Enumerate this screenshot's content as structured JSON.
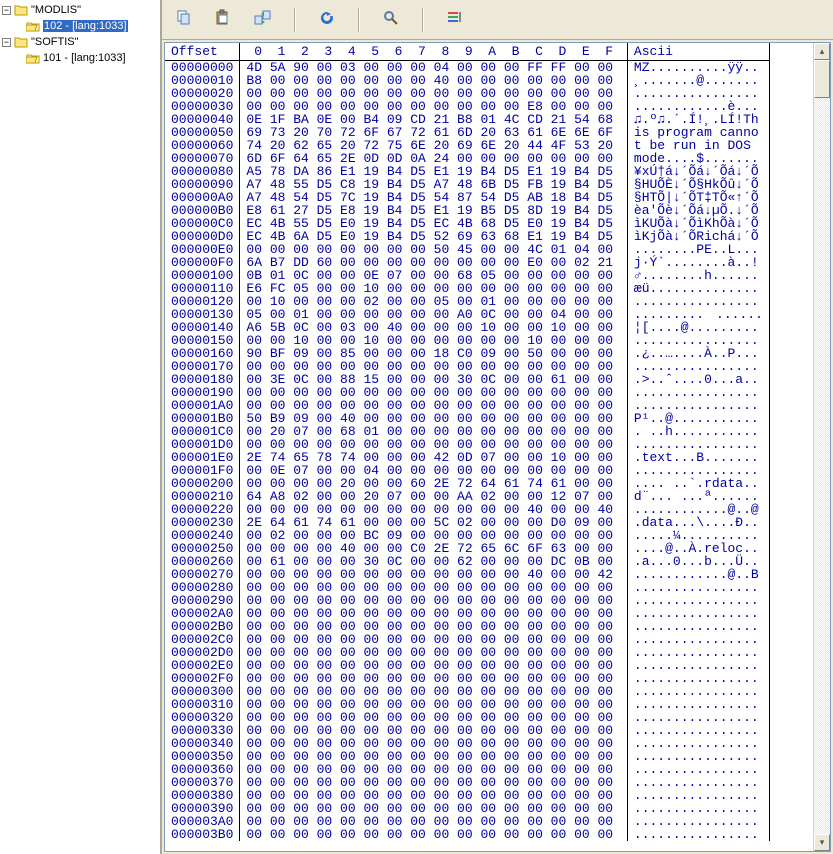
{
  "sidebar": {
    "nodes": [
      {
        "depth": 0,
        "toggle": "−",
        "icon": "folder-closed",
        "label": "\"MODLIS\""
      },
      {
        "depth": 1,
        "toggle": "",
        "icon": "folder-open",
        "label": "102 - [lang:1033]",
        "selected": true
      },
      {
        "depth": 0,
        "toggle": "−",
        "icon": "folder-closed",
        "label": "\"SOFTIS\""
      },
      {
        "depth": 1,
        "toggle": "",
        "icon": "folder-open",
        "label": "101 - [lang:1033]"
      }
    ]
  },
  "toolbar": {
    "buttons": [
      {
        "name": "copy-icon"
      },
      {
        "name": "paste-icon"
      },
      {
        "name": "swap-icon"
      },
      {
        "sep": true
      },
      {
        "name": "refresh-icon"
      },
      {
        "sep": true
      },
      {
        "name": "find-icon"
      },
      {
        "sep": true
      },
      {
        "name": "options-icon"
      }
    ]
  },
  "hex": {
    "header_offset": "Offset",
    "header_cols": [
      "0",
      "1",
      "2",
      "3",
      "4",
      "5",
      "6",
      "7",
      "8",
      "9",
      "A",
      "B",
      "C",
      "D",
      "E",
      "F"
    ],
    "header_ascii": "Ascii",
    "rows": [
      {
        "o": "00000000",
        "h": "4D 5A 90 00 03 00 00 00 04 00 00 00 FF FF 00 00",
        "a": "MZ..........ÿÿ.."
      },
      {
        "o": "00000010",
        "h": "B8 00 00 00 00 00 00 00 40 00 00 00 00 00 00 00",
        "a": "¸.......@......."
      },
      {
        "o": "00000020",
        "h": "00 00 00 00 00 00 00 00 00 00 00 00 00 00 00 00",
        "a": "................"
      },
      {
        "o": "00000030",
        "h": "00 00 00 00 00 00 00 00 00 00 00 00 E8 00 00 00",
        "a": "............è..."
      },
      {
        "o": "00000040",
        "h": "0E 1F BA 0E 00 B4 09 CD 21 B8 01 4C CD 21 54 68",
        "a": "♫.º♫.´.Í!¸.LÍ!Th"
      },
      {
        "o": "00000050",
        "h": "69 73 20 70 72 6F 67 72 61 6D 20 63 61 6E 6E 6F",
        "a": "is program canno"
      },
      {
        "o": "00000060",
        "h": "74 20 62 65 20 72 75 6E 20 69 6E 20 44 4F 53 20",
        "a": "t be run in DOS "
      },
      {
        "o": "00000070",
        "h": "6D 6F 64 65 2E 0D 0D 0A 24 00 00 00 00 00 00 00",
        "a": "mode....$......."
      },
      {
        "o": "00000080",
        "h": "A5 78 DA 86 E1 19 B4 D5 E1 19 B4 D5 E1 19 B4 D5",
        "a": "¥xÚ†á↓´Õá↓´Õá↓´Õ"
      },
      {
        "o": "00000090",
        "h": "A7 48 55 D5 C8 19 B4 D5 A7 48 6B D5 FB 19 B4 D5",
        "a": "§HUÕÈ↓´Õ§HkÕû↓´Õ"
      },
      {
        "o": "000000A0",
        "h": "A7 48 54 D5 7C 19 B4 D5 54 87 54 D5 AB 18 B4 D5",
        "a": "§HTÕ|↓´ÕT‡TÕ«↑´Õ"
      },
      {
        "o": "000000B0",
        "h": "E8 61 27 D5 E8 19 B4 D5 E1 19 B5 D5 8D 19 B4 D5",
        "a": "èa'Õè↓´Õá↓µÕ.↓´Õ"
      },
      {
        "o": "000000C0",
        "h": "EC 4B 55 D5 E0 19 B4 D5 EC 4B 68 D5 E0 19 B4 D5",
        "a": "ìKUÕà↓´ÕìKhÕà↓´Õ"
      },
      {
        "o": "000000D0",
        "h": "EC 4B 6A D5 E0 19 B4 D5 52 69 63 68 E1 19 B4 D5",
        "a": "ìKjÕà↓´ÕRichá↓´Õ"
      },
      {
        "o": "000000E0",
        "h": "00 00 00 00 00 00 00 00 50 45 00 00 4C 01 04 00",
        "a": "........PE..L..."
      },
      {
        "o": "000000F0",
        "h": "6A B7 DD 60 00 00 00 00 00 00 00 00 E0 00 02 21",
        "a": "j·Ý`........à..!"
      },
      {
        "o": "00000100",
        "h": "0B 01 0C 00 00 0E 07 00 00 68 05 00 00 00 00 00",
        "a": "♂........h......"
      },
      {
        "o": "00000110",
        "h": "E6 FC 05 00 00 10 00 00 00 00 00 00 00 00 00 00",
        "a": "æü.............."
      },
      {
        "o": "00000120",
        "h": "00 10 00 00 00 02 00 00 05 00 01 00 00 00 00 00",
        "a": "................"
      },
      {
        "o": "00000130",
        "h": "05 00 01 00 00 00 00 00 00 A0 0C 00 00 04 00 00",
        "a": ".........ﾠ......"
      },
      {
        "o": "00000140",
        "h": "A6 5B 0C 00 03 00 40 00 00 00 10 00 00 10 00 00",
        "a": "¦[....@........."
      },
      {
        "o": "00000150",
        "h": "00 00 10 00 00 10 00 00 00 00 00 00 10 00 00 00",
        "a": "................"
      },
      {
        "o": "00000160",
        "h": "90 BF 09 00 85 00 00 00 18 C0 09 00 50 00 00 00",
        "a": ".¿..…....À..P..."
      },
      {
        "o": "00000170",
        "h": "00 00 00 00 00 00 00 00 00 00 00 00 00 00 00 00",
        "a": "................"
      },
      {
        "o": "00000180",
        "h": "00 3E 0C 00 88 15 00 00 00 30 0C 00 00 61 00 00",
        "a": ".>..ˆ....0...a.."
      },
      {
        "o": "00000190",
        "h": "00 00 00 00 00 00 00 00 00 00 00 00 00 00 00 00",
        "a": "................"
      },
      {
        "o": "000001A0",
        "h": "00 00 00 00 00 00 00 00 00 00 00 00 00 00 00 00",
        "a": "................"
      },
      {
        "o": "000001B0",
        "h": "50 B9 09 00 40 00 00 00 00 00 00 00 00 00 00 00",
        "a": "P¹..@..........."
      },
      {
        "o": "000001C0",
        "h": "00 20 07 00 68 01 00 00 00 00 00 00 00 00 00 00",
        "a": ". ..h..........."
      },
      {
        "o": "000001D0",
        "h": "00 00 00 00 00 00 00 00 00 00 00 00 00 00 00 00",
        "a": "................"
      },
      {
        "o": "000001E0",
        "h": "2E 74 65 78 74 00 00 00 42 0D 07 00 00 10 00 00",
        "a": ".text...B......."
      },
      {
        "o": "000001F0",
        "h": "00 0E 07 00 00 04 00 00 00 00 00 00 00 00 00 00",
        "a": "................"
      },
      {
        "o": "00000200",
        "h": "00 00 00 00 20 00 00 60 2E 72 64 61 74 61 00 00",
        "a": ".... ..`.rdata.."
      },
      {
        "o": "00000210",
        "h": "64 A8 02 00 00 20 07 00 00 AA 02 00 00 12 07 00",
        "a": "d¨... ...ª......"
      },
      {
        "o": "00000220",
        "h": "00 00 00 00 00 00 00 00 00 00 00 00 40 00 00 40",
        "a": "............@..@"
      },
      {
        "o": "00000230",
        "h": "2E 64 61 74 61 00 00 00 5C 02 00 00 00 D0 09 00",
        "a": ".data...\\....Ð.."
      },
      {
        "o": "00000240",
        "h": "00 02 00 00 00 BC 09 00 00 00 00 00 00 00 00 00",
        "a": ".....¼.........."
      },
      {
        "o": "00000250",
        "h": "00 00 00 00 40 00 00 C0 2E 72 65 6C 6F 63 00 00",
        "a": "....@..À.reloc.."
      },
      {
        "o": "00000260",
        "h": "00 61 00 00 00 30 0C 00 00 62 00 00 00 DC 0B 00",
        "a": ".a...0...b...Ü.."
      },
      {
        "o": "00000270",
        "h": "00 00 00 00 00 00 00 00 00 00 00 00 40 00 00 42",
        "a": "............@..B"
      },
      {
        "o": "00000280",
        "h": "00 00 00 00 00 00 00 00 00 00 00 00 00 00 00 00",
        "a": "................"
      },
      {
        "o": "00000290",
        "h": "00 00 00 00 00 00 00 00 00 00 00 00 00 00 00 00",
        "a": "................"
      },
      {
        "o": "000002A0",
        "h": "00 00 00 00 00 00 00 00 00 00 00 00 00 00 00 00",
        "a": "................"
      },
      {
        "o": "000002B0",
        "h": "00 00 00 00 00 00 00 00 00 00 00 00 00 00 00 00",
        "a": "................"
      },
      {
        "o": "000002C0",
        "h": "00 00 00 00 00 00 00 00 00 00 00 00 00 00 00 00",
        "a": "................"
      },
      {
        "o": "000002D0",
        "h": "00 00 00 00 00 00 00 00 00 00 00 00 00 00 00 00",
        "a": "................"
      },
      {
        "o": "000002E0",
        "h": "00 00 00 00 00 00 00 00 00 00 00 00 00 00 00 00",
        "a": "................"
      },
      {
        "o": "000002F0",
        "h": "00 00 00 00 00 00 00 00 00 00 00 00 00 00 00 00",
        "a": "................"
      },
      {
        "o": "00000300",
        "h": "00 00 00 00 00 00 00 00 00 00 00 00 00 00 00 00",
        "a": "................"
      },
      {
        "o": "00000310",
        "h": "00 00 00 00 00 00 00 00 00 00 00 00 00 00 00 00",
        "a": "................"
      },
      {
        "o": "00000320",
        "h": "00 00 00 00 00 00 00 00 00 00 00 00 00 00 00 00",
        "a": "................"
      },
      {
        "o": "00000330",
        "h": "00 00 00 00 00 00 00 00 00 00 00 00 00 00 00 00",
        "a": "................"
      },
      {
        "o": "00000340",
        "h": "00 00 00 00 00 00 00 00 00 00 00 00 00 00 00 00",
        "a": "................"
      },
      {
        "o": "00000350",
        "h": "00 00 00 00 00 00 00 00 00 00 00 00 00 00 00 00",
        "a": "................"
      },
      {
        "o": "00000360",
        "h": "00 00 00 00 00 00 00 00 00 00 00 00 00 00 00 00",
        "a": "................"
      },
      {
        "o": "00000370",
        "h": "00 00 00 00 00 00 00 00 00 00 00 00 00 00 00 00",
        "a": "................"
      },
      {
        "o": "00000380",
        "h": "00 00 00 00 00 00 00 00 00 00 00 00 00 00 00 00",
        "a": "................"
      },
      {
        "o": "00000390",
        "h": "00 00 00 00 00 00 00 00 00 00 00 00 00 00 00 00",
        "a": "................"
      },
      {
        "o": "000003A0",
        "h": "00 00 00 00 00 00 00 00 00 00 00 00 00 00 00 00",
        "a": "................"
      },
      {
        "o": "000003B0",
        "h": "00 00 00 00 00 00 00 00 00 00 00 00 00 00 00 00",
        "a": "................"
      }
    ]
  }
}
